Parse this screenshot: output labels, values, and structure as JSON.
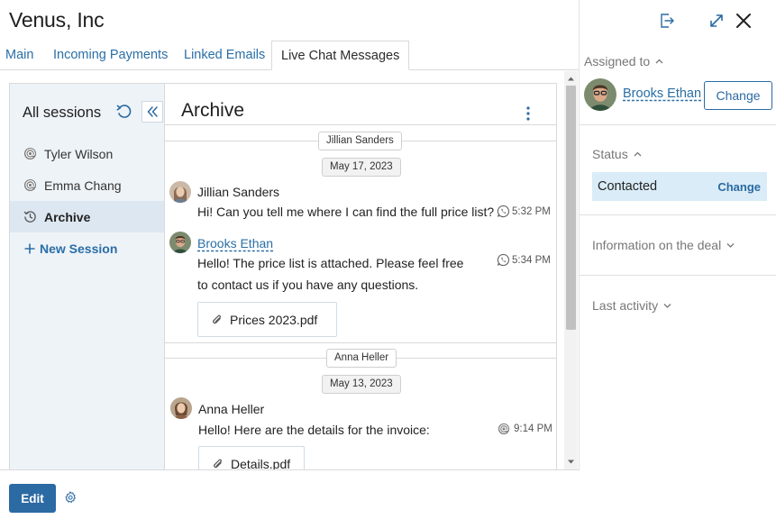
{
  "header": {
    "title": "Venus, Inc"
  },
  "tabs": [
    {
      "label": "Main"
    },
    {
      "label": "Incoming Payments"
    },
    {
      "label": "Linked Emails"
    },
    {
      "label": "Live Chat Messages",
      "active": true
    }
  ],
  "sessions": {
    "title": "All sessions",
    "items": [
      {
        "label": "Tyler Wilson",
        "icon": "at-icon"
      },
      {
        "label": "Emma Chang",
        "icon": "at-icon"
      },
      {
        "label": "Archive",
        "icon": "history-icon",
        "active": true
      },
      {
        "label": "New Session",
        "icon": "plus-icon"
      }
    ]
  },
  "chat": {
    "title": "Archive",
    "groups": [
      {
        "participant": "Jillian Sanders",
        "date": "May 17, 2023",
        "messages": [
          {
            "author": "Jillian Sanders",
            "author_is_link": false,
            "lines": [
              "Hi! Can you tell me where I can find the full price list?"
            ],
            "channel_icon": "whatsapp-icon",
            "time": "5:32 PM"
          },
          {
            "author": "Brooks Ethan",
            "author_is_link": true,
            "lines": [
              "Hello! The price list is attached. Please feel free",
              "to contact us  if you have any questions."
            ],
            "channel_icon": "whatsapp-icon",
            "time": "5:34 PM",
            "attachment": "Prices 2023.pdf"
          }
        ]
      },
      {
        "participant": "Anna Heller",
        "date": "May 13, 2023",
        "messages": [
          {
            "author": "Anna Heller",
            "author_is_link": false,
            "lines": [
              "Hello! Here are the details for the invoice:"
            ],
            "channel_icon": "at-icon",
            "time": "9:14 PM",
            "attachment": "Details.pdf"
          }
        ]
      }
    ]
  },
  "footer": {
    "edit_label": "Edit"
  },
  "right_panel": {
    "assigned_label": "Assigned to",
    "assignee": "Brooks Ethan",
    "change_label": "Change",
    "status_label": "Status",
    "status_value": "Contacted",
    "status_change_label": "Change",
    "deal_label": "Information on the deal",
    "activity_label": "Last activity"
  },
  "colors": {
    "accent": "#2b6aa3",
    "link": "#2a6ea6",
    "sidebar_bg": "#eef3f8",
    "status_bg": "#d9ecf7"
  }
}
